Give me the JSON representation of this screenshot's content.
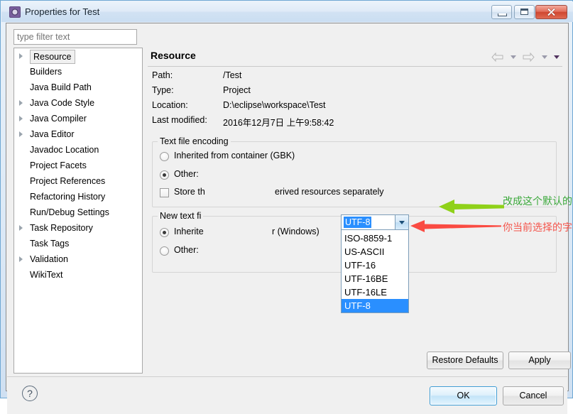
{
  "window": {
    "title": "Properties for Test",
    "icon": "gear-icon",
    "buttons": {
      "minimize": "minimize-icon",
      "maximize": "restore-icon",
      "close": "close-icon"
    }
  },
  "sidebar": {
    "filter_placeholder": "type filter text",
    "items": [
      {
        "label": "Resource",
        "expandable": true,
        "selected": true
      },
      {
        "label": "Builders",
        "expandable": false,
        "selected": false
      },
      {
        "label": "Java Build Path",
        "expandable": false,
        "selected": false
      },
      {
        "label": "Java Code Style",
        "expandable": true,
        "selected": false
      },
      {
        "label": "Java Compiler",
        "expandable": true,
        "selected": false
      },
      {
        "label": "Java Editor",
        "expandable": true,
        "selected": false
      },
      {
        "label": "Javadoc Location",
        "expandable": false,
        "selected": false
      },
      {
        "label": "Project Facets",
        "expandable": false,
        "selected": false
      },
      {
        "label": "Project References",
        "expandable": false,
        "selected": false
      },
      {
        "label": "Refactoring History",
        "expandable": false,
        "selected": false
      },
      {
        "label": "Run/Debug Settings",
        "expandable": false,
        "selected": false
      },
      {
        "label": "Task Repository",
        "expandable": true,
        "selected": false
      },
      {
        "label": "Task Tags",
        "expandable": false,
        "selected": false
      },
      {
        "label": "Validation",
        "expandable": true,
        "selected": false
      },
      {
        "label": "WikiText",
        "expandable": false,
        "selected": false
      }
    ]
  },
  "page": {
    "title": "Resource",
    "nav": {
      "back": "back-arrow-icon",
      "forward": "forward-arrow-icon",
      "menu": "view-menu-icon"
    },
    "info": [
      {
        "key": "Path:",
        "value": "/Test"
      },
      {
        "key": "Type:",
        "value": "Project"
      },
      {
        "key": "Location:",
        "value": "D:\\eclipse\\workspace\\Test"
      },
      {
        "key": "Last modified:",
        "value": "2016年12月7日 上午9:58:42"
      }
    ],
    "encoding_group": {
      "legend": "Text file encoding",
      "inherited_label": "Inherited from container (GBK)",
      "inherited_selected": false,
      "other_label": "Other:",
      "other_selected": true,
      "store_checkbox_label_left": "Store th",
      "store_checkbox_label_right": "erived resources separately",
      "store_checked": false
    },
    "delimiter_group": {
      "legend_left": "New text fi",
      "inherited_label_left": "Inherite",
      "inherited_label_right": "r (Windows)",
      "inherited_selected": true,
      "other_label": "Other:",
      "other_selected": false
    },
    "combo": {
      "value": "UTF-8",
      "expanded": true,
      "options": [
        "ISO-8859-1",
        "US-ASCII",
        "UTF-16",
        "UTF-16BE",
        "UTF-16LE",
        "UTF-8"
      ],
      "selected_option": "UTF-8"
    },
    "annotations": [
      {
        "text": "改成这个默认的字符编码",
        "color": "#3aa83a",
        "arrow": "green-left-arrow"
      },
      {
        "text": "你当前选择的字符编码",
        "color": "#f4534a",
        "arrow": "red-left-arrow"
      }
    ],
    "buttons": {
      "restore_defaults": "Restore Defaults",
      "apply": "Apply"
    }
  },
  "footer": {
    "help": "?",
    "ok": "OK",
    "cancel": "Cancel"
  }
}
